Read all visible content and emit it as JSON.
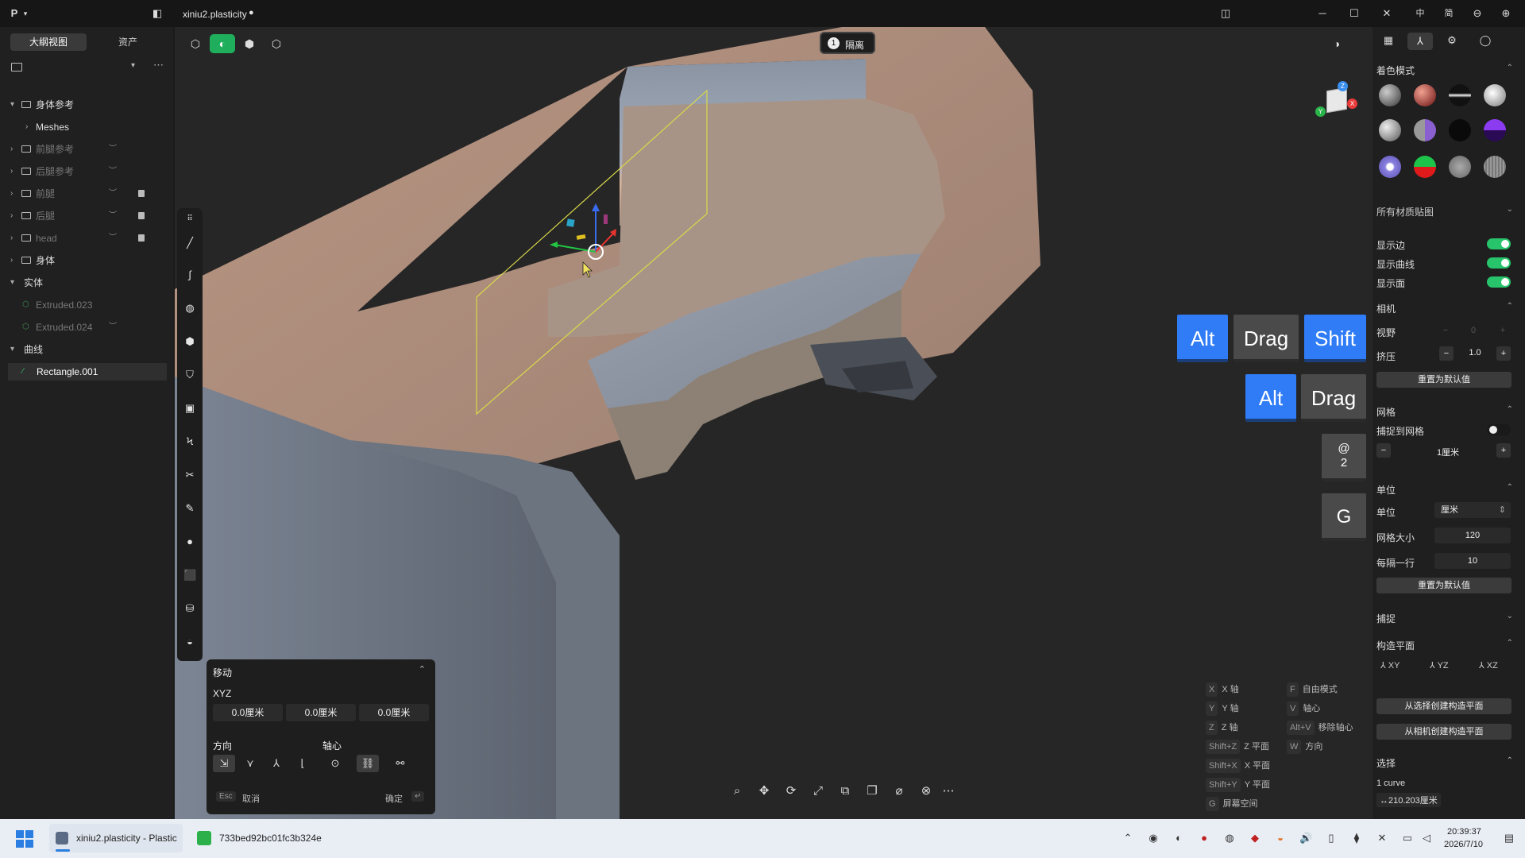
{
  "window": {
    "title": "xiniu2.plasticity",
    "unsaved_dot": "●"
  },
  "left_panel": {
    "tabs": [
      "大纲视图",
      "资产"
    ],
    "tree": [
      {
        "label": "身体参考",
        "type": "folder",
        "expanded": true,
        "dim": false
      },
      {
        "label": "Meshes",
        "type": "child",
        "expanded": false,
        "dim": false
      },
      {
        "label": "前腿参考",
        "type": "folder",
        "expanded": false,
        "dim": true
      },
      {
        "label": "后腿参考",
        "type": "folder",
        "expanded": false,
        "dim": true
      },
      {
        "label": "前腿",
        "type": "folder",
        "expanded": false,
        "dim": true
      },
      {
        "label": "后腿",
        "type": "folder",
        "expanded": false,
        "dim": true
      },
      {
        "label": "head",
        "type": "folder",
        "expanded": false,
        "dim": true
      },
      {
        "label": "身体",
        "type": "folder",
        "expanded": false,
        "dim": false
      },
      {
        "label": "实体",
        "type": "section",
        "expanded": true,
        "dim": false
      },
      {
        "label": "Extruded.023",
        "type": "solid",
        "dim": true
      },
      {
        "label": "Extruded.024",
        "type": "solid",
        "dim": true
      },
      {
        "label": "曲线",
        "type": "section",
        "expanded": true,
        "dim": false
      },
      {
        "label": "Rectangle.001",
        "type": "curve",
        "selected": true,
        "dim": false
      }
    ]
  },
  "viewport": {
    "isolate_label": "隔离",
    "isolate_count": "1",
    "key_overlays": {
      "row1": [
        "Alt",
        "Drag",
        "Shift"
      ],
      "row2": [
        "Alt",
        "Drag"
      ],
      "at": "@",
      "at_num": "2",
      "g": "G"
    },
    "shortcuts_left": [
      {
        "key": "X",
        "label": "X 轴"
      },
      {
        "key": "Y",
        "label": "Y 轴"
      },
      {
        "key": "Z",
        "label": "Z 轴"
      },
      {
        "key": "Shift+Z",
        "label": "Z 平面"
      },
      {
        "key": "Shift+X",
        "label": "X 平面"
      },
      {
        "key": "Shift+Y",
        "label": "Y 平面"
      },
      {
        "key": "G",
        "label": "屏幕空间"
      }
    ],
    "shortcuts_right": [
      {
        "key": "F",
        "label": "自由模式"
      },
      {
        "key": "V",
        "label": "轴心"
      },
      {
        "key": "Alt+V",
        "label": "移除轴心"
      },
      {
        "key": "W",
        "label": "方向"
      }
    ]
  },
  "move_panel": {
    "title": "移动",
    "xyz_label": "XYZ",
    "values": [
      "0.0厘米",
      "0.0厘米",
      "0.0厘米"
    ],
    "direction_label": "方向",
    "pivot_label": "轴心",
    "esc_key": "Esc",
    "cancel": "取消",
    "confirm": "确定",
    "enter_key": "↵"
  },
  "right_panel": {
    "shading_title": "着色模式",
    "material_dropdown": "所有材质贴图",
    "toggles": [
      "显示边",
      "显示曲线",
      "显示面"
    ],
    "camera_title": "相机",
    "fov_label": "视野",
    "fov_value": "0",
    "extrude_label": "挤压",
    "extrude_value": "1.0",
    "reset_label": "重置为默认值",
    "grid_title": "网格",
    "snap_to_grid": "捕捉到网格",
    "grid_value": "1厘米",
    "units_title": "单位",
    "unit_label": "单位",
    "unit_value": "厘米",
    "grid_size_label": "网格大小",
    "grid_size_value": "120",
    "every_row_label": "每隔一行",
    "every_row_value": "10",
    "snap_title": "捕捉",
    "cplane_title": "构造平面",
    "cplane_options": [
      "XY",
      "YZ",
      "XZ"
    ],
    "from_selection": "从选择创建构造平面",
    "from_camera": "从相机创建构造平面",
    "selection_title": "选择",
    "selection_count": "1 curve",
    "selection_length": "↔210.203厘米"
  },
  "taskbar": {
    "app1": "xiniu2.plasticity - Plastic",
    "app2": "733bed92bc01fc3b324e",
    "time": "20:39:37",
    "date": "2026/7/10"
  },
  "title_right": [
    "中",
    "简"
  ],
  "colors": {
    "accent_green": "#27c46b",
    "key_blue": "#2f7cf6",
    "selection_yellow": "#d9d94a"
  }
}
